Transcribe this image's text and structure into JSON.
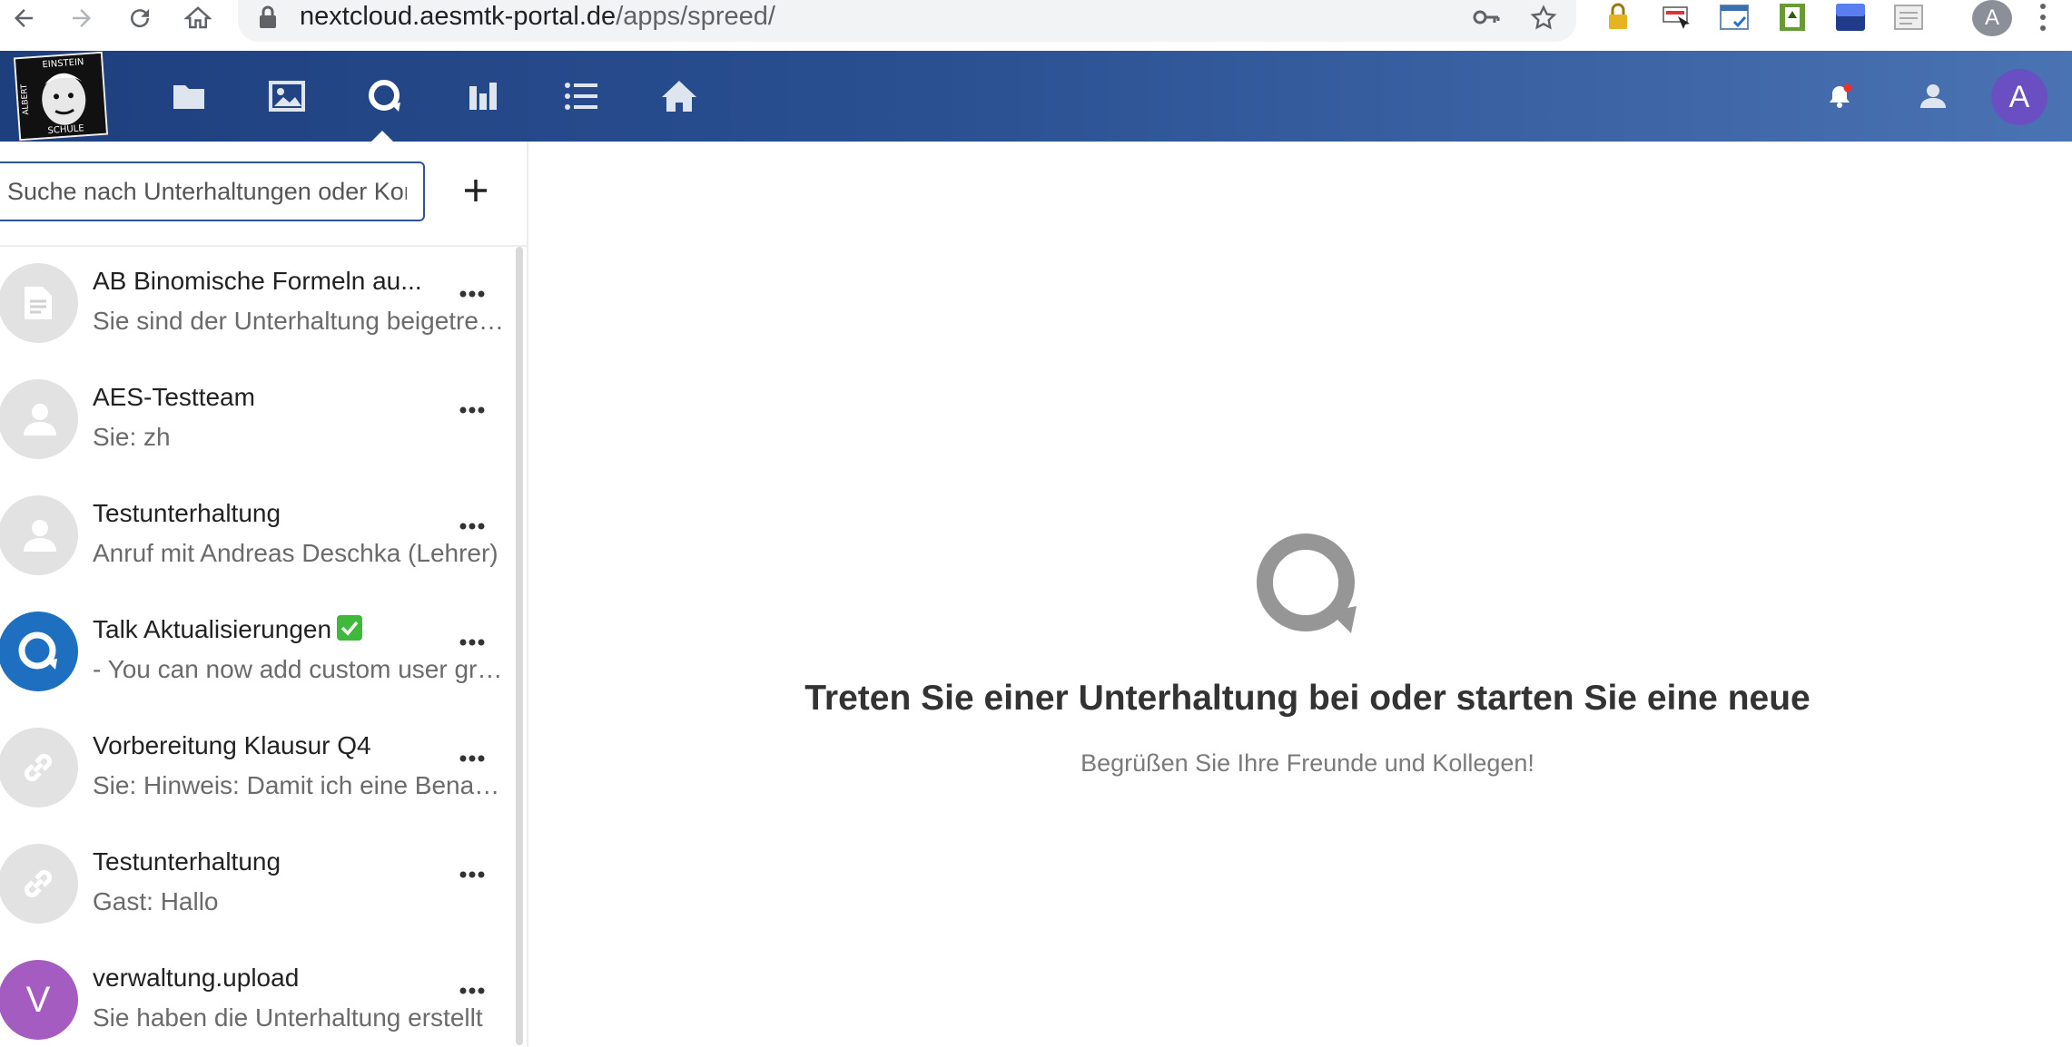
{
  "browser": {
    "url_host": "nextcloud.aesmtk-portal.de",
    "url_path": "/apps/spreed/",
    "profile_initial": "A",
    "back_icon": "arrow-left-icon",
    "forward_icon": "arrow-right-icon",
    "reload_icon": "reload-icon",
    "home_icon": "home-icon"
  },
  "header": {
    "logo_text_top": "EINSTEIN",
    "logo_text_side": "ALBERT",
    "logo_text_bottom": "SCHULE",
    "apps": [
      {
        "name": "files",
        "icon": "folder-icon"
      },
      {
        "name": "photos",
        "icon": "image-icon"
      },
      {
        "name": "talk",
        "icon": "talk-icon",
        "active": true
      },
      {
        "name": "activity",
        "icon": "chart-icon"
      },
      {
        "name": "tasks",
        "icon": "list-icon"
      },
      {
        "name": "home",
        "icon": "house-icon"
      }
    ],
    "user_initial": "A",
    "colors": {
      "header_start": "#1e3f7e",
      "header_end": "#4a73b3",
      "notification_dot": "#e9322d",
      "user_avatar": "#6a4fc3"
    }
  },
  "sidebar": {
    "search_placeholder": "Suche nach Unterhaltungen oder Kontakten",
    "add_label": "+",
    "conversations": [
      {
        "name": "AB Binomische Formeln au...",
        "subtitle": "Sie sind der Unterhaltung beigetreten",
        "avatar": "file-icon"
      },
      {
        "name": "AES-Testteam",
        "subtitle": "Sie: zh",
        "avatar": "group-icon"
      },
      {
        "name": "Testunterhaltung",
        "subtitle": "Anruf mit Andreas Deschka (Lehrer)",
        "avatar": "group-icon"
      },
      {
        "name": "Talk Aktualisierungen",
        "subtitle": "- You can now add custom user groups",
        "avatar": "talk-icon"
      },
      {
        "name": "Vorbereitung Klausur Q4",
        "subtitle": "Sie: Hinweis: Damit ich eine Benachrichtigung",
        "avatar": "link-icon"
      },
      {
        "name": "Testunterhaltung",
        "subtitle": "Gast: Hallo",
        "avatar": "link-icon"
      },
      {
        "name": "verwaltung.upload",
        "subtitle": "Sie haben die Unterhaltung erstellt",
        "avatar_letter": "V",
        "avatar_color": "#a45cc0"
      }
    ]
  },
  "empty": {
    "title": "Treten Sie einer Unterhaltung bei oder starten Sie eine neue",
    "subtitle": "Begrüßen Sie Ihre Freunde und Kollegen!",
    "icon": "talk-icon"
  }
}
